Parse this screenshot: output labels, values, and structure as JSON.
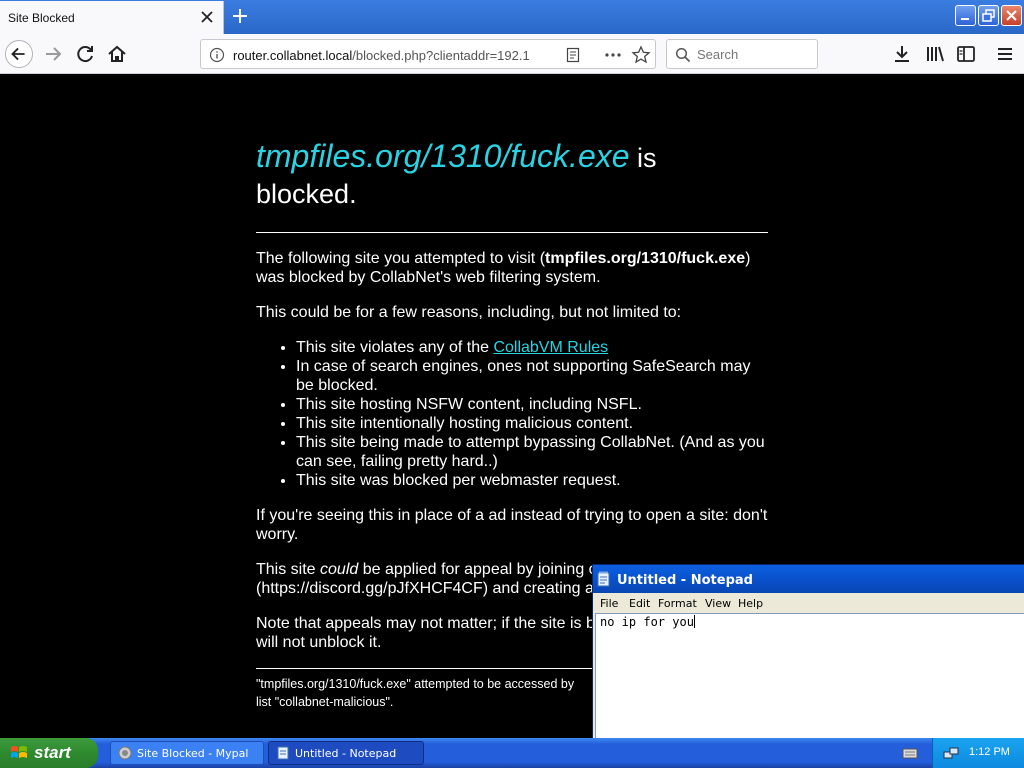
{
  "browser": {
    "tab_title": "Site Blocked",
    "url_host": "router.collabnet.local",
    "url_path": "/blocked.php?clientaddr=192.1",
    "search_placeholder": "Search"
  },
  "page": {
    "headline_site": "tmpfiles.org/1310/fuck.exe",
    "headline_rest_1": " is",
    "headline_rest_2": "blocked.",
    "intro_part1": "The following site you attempted to visit (",
    "intro_site": "tmpfiles.org/1310/fuck.exe",
    "intro_part2": ") was blocked by CollabNet's web filtering system.",
    "reasons_intro": "This could be for a few reasons, including, but not limited to:",
    "reason_1_text": "This site violates any of the ",
    "reason_1_link": "CollabVM Rules",
    "reasons": [
      "In case of search engines, ones not supporting SafeSearch may be blocked.",
      "This site hosting NSFW content, including NSFL.",
      "This site intentionally hosting malicious content.",
      "This site being made to attempt bypassing CollabNet. (And as you can see, failing pretty hard..)",
      "This site was blocked per webmaster request."
    ],
    "ad_note": "If you're seeing this in place of a ad instead of trying to open a site: don't worry.",
    "appeal_part1": "This site ",
    "appeal_could": "could",
    "appeal_part2": " be applied for appeal by joining o",
    "appeal_line2": "(https://discord.gg/pJfXHCF4CF) and creating a",
    "appeals_note_line1": "Note that appeals may not matter; if the site is blo",
    "appeals_note_line2": "will not unblock it.",
    "footer_line1": "\"tmpfiles.org/1310/fuck.exe\" attempted to be accessed by",
    "footer_line2": "list \"collabnet-malicious\"."
  },
  "notepad": {
    "title": "Untitled - Notepad",
    "menu": [
      "File",
      "Edit",
      "Format",
      "View",
      "Help"
    ],
    "text": "no ip for you"
  },
  "taskbar": {
    "start_label": "start",
    "tasks": [
      "Site Blocked - Mypal",
      "Untitled - Notepad"
    ],
    "clock": "1:12 PM"
  },
  "colors": {
    "link": "#29d3e3",
    "page_background": "#000000",
    "taskbar_blue": "#245edb",
    "start_green": "#2f8a2f"
  }
}
